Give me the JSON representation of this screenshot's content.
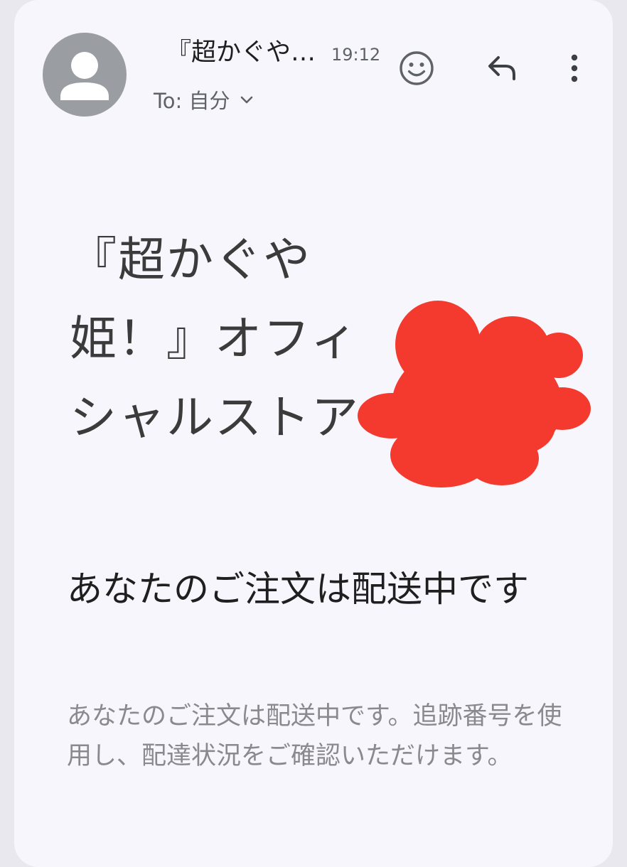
{
  "header": {
    "subject": "『超かぐや…",
    "time": "19:12",
    "to_label": "To: 自分",
    "avatar_icon": "person-avatar-icon",
    "emoji_icon": "emoji-reaction-icon",
    "reply_icon": "reply-icon",
    "more_icon": "more-vert-icon"
  },
  "body": {
    "store_name": "『超かぐや姫！』オフィシャルストア",
    "status_title": "あなたのご注文は配送中です",
    "description": "あなたのご注文は配送中です。追跡番号を使用し、配達状況をご確認いただけます。"
  },
  "colors": {
    "card_background": "#f7f6fc",
    "avatar_gray": "#9a9da2",
    "redaction_red": "#f43a2e"
  }
}
